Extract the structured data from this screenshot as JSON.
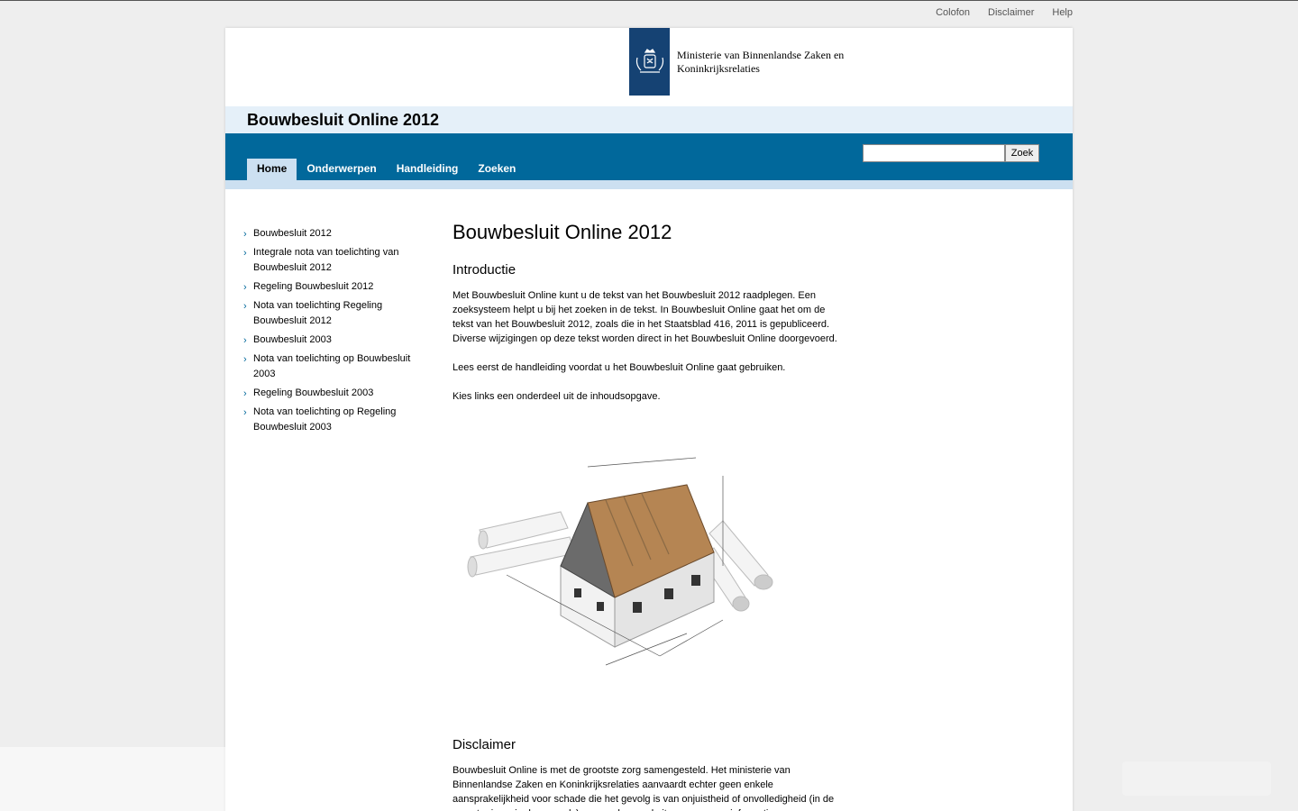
{
  "top_links": [
    "Colofon",
    "Disclaimer",
    "Help"
  ],
  "ministry": {
    "line1": "Ministerie van Binnenlandse Zaken en",
    "line2": "Koninkrijksrelaties"
  },
  "site_title": "Bouwbesluit Online 2012",
  "nav": [
    "Home",
    "Onderwerpen",
    "Handleiding",
    "Zoeken"
  ],
  "search": {
    "placeholder": "",
    "button": "Zoek"
  },
  "sidebar": [
    "Bouwbesluit 2012",
    "Integrale nota van toelichting van Bouwbesluit 2012",
    "Regeling Bouwbesluit 2012",
    "Nota van toelichting Regeling Bouwbesluit 2012",
    "Bouwbesluit 2003",
    "Nota van toelichting op Bouwbesluit 2003",
    "Regeling Bouwbesluit 2003",
    "Nota van toelichting op Regeling Bouwbesluit 2003"
  ],
  "main": {
    "title": "Bouwbesluit Online 2012",
    "intro_heading": "Introductie",
    "intro_p1": "Met Bouwbesluit Online kunt u de tekst van het Bouwbesluit 2012 raadplegen. Een zoeksysteem helpt u bij het zoeken in de tekst. In Bouwbesluit Online gaat het om de tekst van het Bouwbesluit 2012, zoals die in het Staatsblad 416, 2011 is gepubliceerd. Diverse wijzigingen op deze tekst worden direct in het Bouwbesluit Online doorgevoerd.",
    "intro_p2": "Lees eerst de handleiding voordat u het Bouwbesluit Online gaat gebruiken.",
    "intro_p3": "Kies links een onderdeel uit de inhoudsopgave.",
    "disclaimer_heading": "Disclaimer",
    "disclaimer_p": "Bouwbesluit Online is met de grootste zorg samengesteld. Het ministerie van Binnenlandse Zaken en Koninkrijksrelaties aanvaardt echter geen enkele aansprakelijkheid voor schade die het gevolg is van onjuistheid of onvolledigheid (in de meest ruime zin des woords) van en deze website opgenomen informatie."
  }
}
